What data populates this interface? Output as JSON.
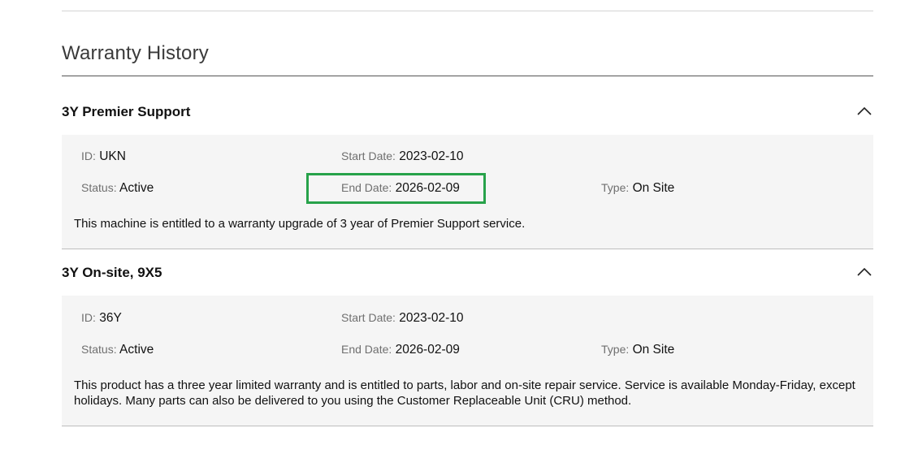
{
  "section": {
    "title": "Warranty History"
  },
  "warranties": [
    {
      "name": "3Y Premier Support",
      "id_label": "ID",
      "id_value": "UKN",
      "start_label": "Start Date",
      "start_value": "2023-02-10",
      "status_label": "Status",
      "status_value": "Active",
      "end_label": "End Date",
      "end_value": "2026-02-09",
      "type_label": "Type",
      "type_value": "On Site",
      "description": "This machine is entitled to a warranty upgrade of 3 year of Premier Support service."
    },
    {
      "name": "3Y On-site, 9X5",
      "id_label": "ID",
      "id_value": "36Y",
      "start_label": "Start Date",
      "start_value": "2023-02-10",
      "status_label": "Status",
      "status_value": "Active",
      "end_label": "End Date",
      "end_value": "2026-02-09",
      "type_label": "Type",
      "type_value": "On Site",
      "description": "This product has a three year limited warranty and is entitled to parts, labor and on-site repair service. Service is available Monday-Friday, except holidays. Many parts can also be delivered to you using the Customer Replaceable Unit (CRU) method."
    }
  ],
  "colors": {
    "highlight": "#27a24a",
    "panel_bg": "#f5f5f5"
  },
  "icons": {
    "collapse": "chevron-up-icon"
  }
}
